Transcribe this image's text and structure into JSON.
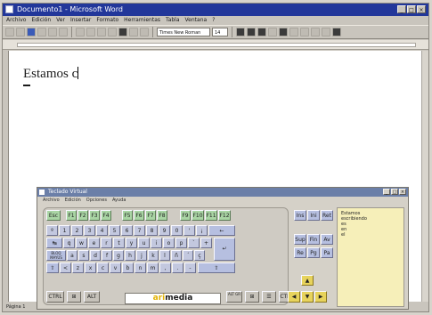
{
  "word": {
    "title": "Documento1 - Microsoft Word",
    "window_controls": [
      "_",
      "□",
      "×"
    ],
    "menu": [
      "Archivo",
      "Edición",
      "Ver",
      "Insertar",
      "Formato",
      "Herramientas",
      "Tabla",
      "Ventana",
      "?"
    ],
    "font_name": "Times New Roman",
    "font_size": "14",
    "document_text": "Estamos c",
    "status": "Página 1"
  },
  "osk": {
    "title": "Teclado Virtual",
    "window_controls": [
      "_",
      "□",
      "×"
    ],
    "menu": [
      "Archivo",
      "Edición",
      "Opciones",
      "Ayuda"
    ],
    "fkeys_left": [
      "Esc",
      "F1",
      "F2",
      "F3",
      "F4"
    ],
    "fkeys_mid": [
      "F5",
      "F6",
      "F7",
      "F8"
    ],
    "fkeys_right": [
      "F9",
      "F10",
      "F11",
      "F12"
    ],
    "nav_top": [
      "Ins",
      "Ini",
      "Ret"
    ],
    "row_numbers": [
      "º",
      "1",
      "2",
      "3",
      "4",
      "5",
      "6",
      "7",
      "8",
      "9",
      "0",
      "'",
      "¡"
    ],
    "backspace": "←",
    "tab": "↹",
    "row_qwerty": [
      "q",
      "w",
      "e",
      "r",
      "t",
      "y",
      "u",
      "i",
      "o",
      "p",
      "`",
      "+"
    ],
    "enter": "↵",
    "caps": "BLOQ MAYÚS",
    "row_asdf": [
      "a",
      "s",
      "d",
      "f",
      "g",
      "h",
      "j",
      "k",
      "l",
      "ñ",
      "´",
      "ç"
    ],
    "shift_left": "⇧",
    "row_zxcv": [
      "<",
      "z",
      "x",
      "c",
      "v",
      "b",
      "n",
      "m",
      ",",
      ".",
      "-"
    ],
    "shift_right": "⇧",
    "nav_mid_1": [
      "Sup",
      "Fin",
      "Av"
    ],
    "nav_mid_2": [
      "Re",
      "Pg",
      "Pa"
    ],
    "bottom_left": [
      "CTRL",
      "⊞",
      "ALT"
    ],
    "brand_part1": "ari",
    "brand_part2": "media",
    "bottom_right": [
      "ALT GR",
      "⊞",
      "☰",
      "CTRL"
    ],
    "arrows": [
      "▲",
      "◀",
      "▼",
      "▶"
    ],
    "prediction_words": [
      "Estamos",
      "escribiendo",
      "es",
      "en",
      "el"
    ]
  }
}
